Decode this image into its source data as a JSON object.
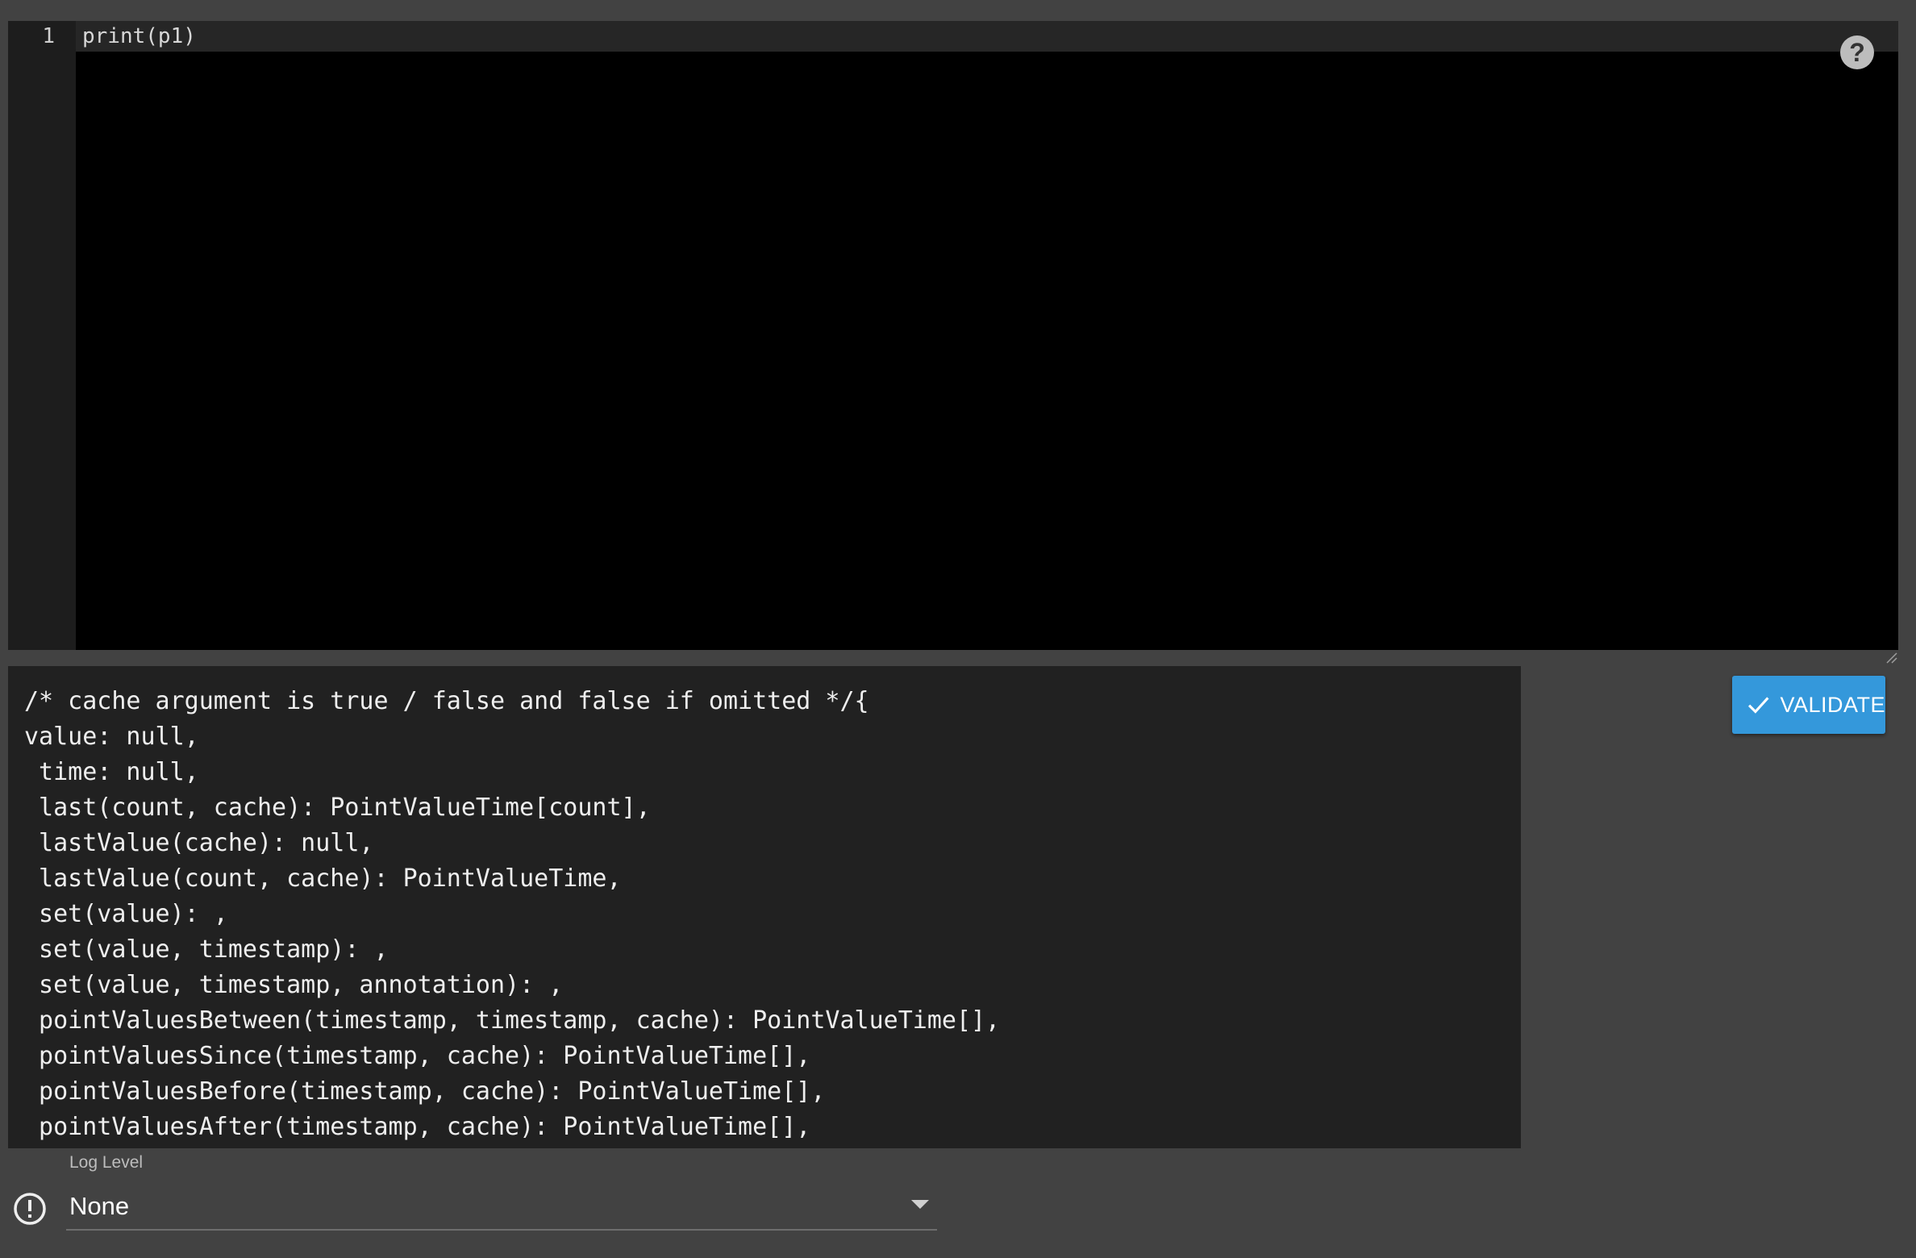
{
  "editor": {
    "lines": [
      {
        "number": "1",
        "code": "print(p1)"
      }
    ]
  },
  "help": {
    "glyph": "?",
    "icon": "help-icon"
  },
  "hints": {
    "text": "/* cache argument is true / false and false if omitted */{\nvalue: null,\n time: null,\n last(count, cache): PointValueTime[count],\n lastValue(cache): null,\n lastValue(count, cache): PointValueTime,\n set(value): ,\n set(value, timestamp): ,\n set(value, timestamp, annotation): ,\n pointValuesBetween(timestamp, timestamp, cache): PointValueTime[],\n pointValuesSince(timestamp, cache): PointValueTime[],\n pointValuesBefore(timestamp, cache): PointValueTime[],\n pointValuesAfter(timestamp, cache): PointValueTime[],"
  },
  "validate": {
    "label": "VALIDATE",
    "icon": "check-icon",
    "color": "#3498db"
  },
  "log_level": {
    "label": "Log Level",
    "selected": "None",
    "icon": "alert-circle-icon"
  }
}
